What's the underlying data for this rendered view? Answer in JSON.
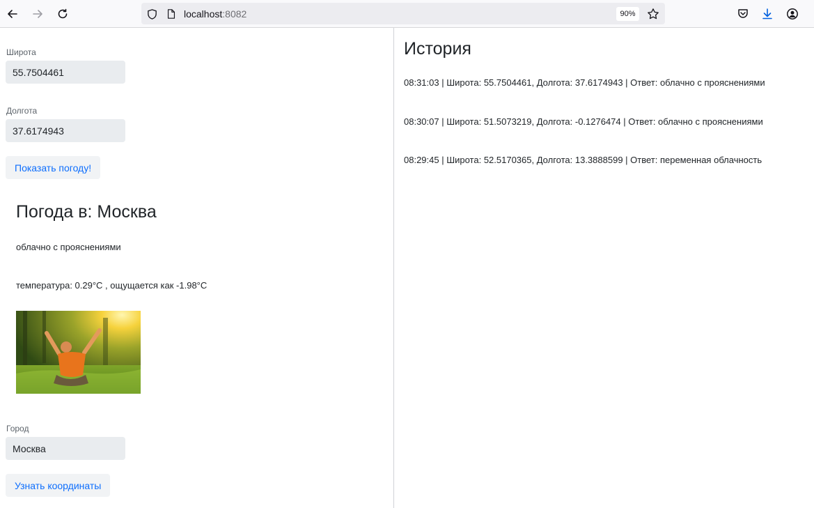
{
  "browser": {
    "url_host": "localhost",
    "url_port": ":8082",
    "zoom": "90%"
  },
  "coords_form": {
    "lat_label": "Широта",
    "lat_value": "55.7504461",
    "lon_label": "Долгота",
    "lon_value": "37.6174943",
    "submit_label": "Показать погоду!"
  },
  "weather": {
    "title": "Погода в: Москва",
    "description": "облачно с прояснениями",
    "temperature_text": "температура: 0.29°C , ощущается как -1.98°C"
  },
  "city_form": {
    "city_label": "Город",
    "city_value": "Москва",
    "submit_label": "Узнать координаты"
  },
  "history": {
    "title": "История",
    "items": [
      "08:31:03 | Широта: 55.7504461, Долгота: 37.6174943 | Ответ: облачно с прояснениями",
      "08:30:07 | Широта: 51.5073219, Долгота: -0.1276474 | Ответ: облачно с прояснениями",
      "08:29:45 | Широта: 52.5170365, Долгота: 13.3888599 | Ответ: переменная облачность"
    ]
  }
}
